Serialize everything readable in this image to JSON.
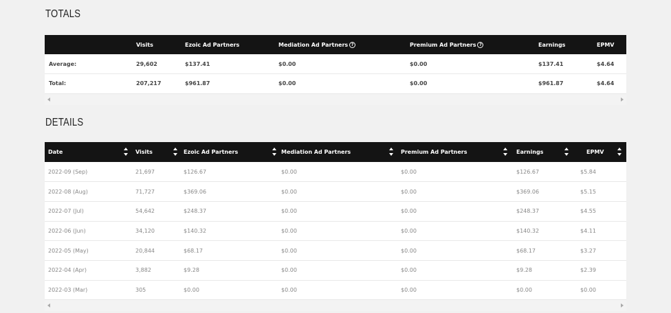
{
  "totals": {
    "title": "TOTALS",
    "headers": [
      "",
      "Visits",
      "Ezoic Ad Partners",
      "Mediation Ad Partners",
      "Premium Ad Partners",
      "Earnings",
      "EPMV"
    ],
    "rows": [
      [
        "Average:",
        "29,602",
        "$137.41",
        "$0.00",
        "$0.00",
        "$137.41",
        "$4.64"
      ],
      [
        "Total:",
        "207,217",
        "$961.87",
        "$0.00",
        "$0.00",
        "$961.87",
        "$4.64"
      ]
    ]
  },
  "details": {
    "title": "DETAILS",
    "headers": [
      "Date",
      "Visits",
      "Ezoic Ad Partners",
      "Mediation Ad Partners",
      "Premium Ad Partners",
      "Earnings",
      "EPMV"
    ],
    "rows": [
      [
        "2022-09 (Sep)",
        "21,697",
        "$126.67",
        "$0.00",
        "$0.00",
        "$126.67",
        "$5.84"
      ],
      [
        "2022-08 (Aug)",
        "71,727",
        "$369.06",
        "$0.00",
        "$0.00",
        "$369.06",
        "$5.15"
      ],
      [
        "2022-07 (Jul)",
        "54,642",
        "$248.37",
        "$0.00",
        "$0.00",
        "$248.37",
        "$4.55"
      ],
      [
        "2022-06 (Jun)",
        "34,120",
        "$140.32",
        "$0.00",
        "$0.00",
        "$140.32",
        "$4.11"
      ],
      [
        "2022-05 (May)",
        "20,844",
        "$68.17",
        "$0.00",
        "$0.00",
        "$68.17",
        "$3.27"
      ],
      [
        "2022-04 (Apr)",
        "3,882",
        "$9.28",
        "$0.00",
        "$0.00",
        "$9.28",
        "$2.39"
      ],
      [
        "2022-03 (Mar)",
        "305",
        "$0.00",
        "$0.00",
        "$0.00",
        "$0.00",
        "$0.00"
      ]
    ]
  },
  "icons": {
    "help": "help-circle-icon",
    "sort": "sort-icon",
    "scroll_left": "scroll-left-icon",
    "scroll_right": "scroll-right-icon"
  },
  "colors": {
    "header_bg": "#141414",
    "page_bg": "#f1f1f1"
  }
}
